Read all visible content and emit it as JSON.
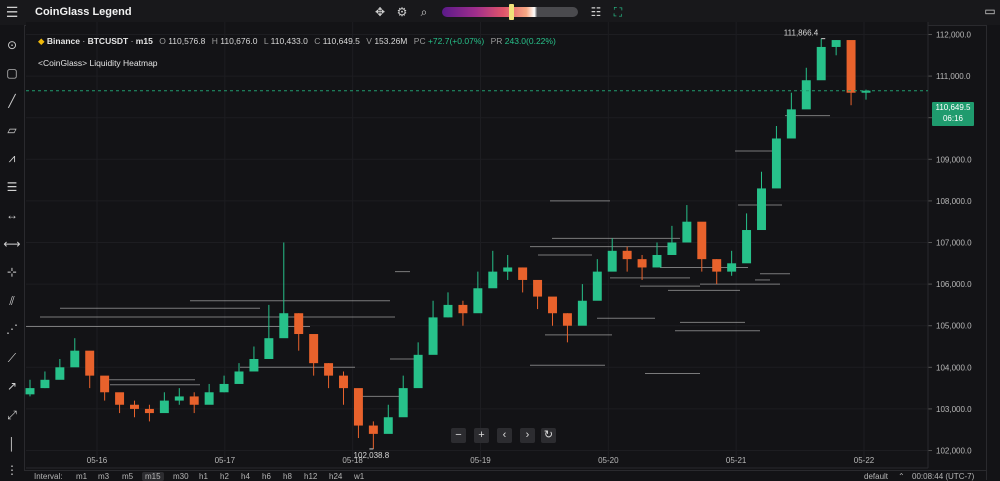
{
  "app": {
    "title": "CoinGlass Legend"
  },
  "legend": {
    "exchange": "Binance",
    "symbol": "BTCUSDT",
    "interval": "m15",
    "open_label": "O",
    "open": "110,576.8",
    "high_label": "H",
    "high": "110,676.0",
    "low_label": "L",
    "low": "110,433.0",
    "close_label": "C",
    "close": "110,649.5",
    "volume_label": "V",
    "volume": "153.26M",
    "pc_label": "PC",
    "pc": "+72.7(+0.07%)",
    "pr_label": "PR",
    "pr": "243.0(0.22%)"
  },
  "indicator": {
    "label": "<CoinGlass> Liquidity Heatmap"
  },
  "price_axis": {
    "ticks": [
      "112,000.0",
      "111,000.0",
      "110,000.0",
      "109,000.0",
      "108,000.0",
      "107,000.0",
      "106,000.0",
      "105,000.0",
      "104,000.0",
      "103,000.0",
      "102,000.0"
    ],
    "current_price": "110,649.5",
    "countdown": "06:16"
  },
  "time_axis": {
    "ticks": [
      "05-16",
      "05-17",
      "05-18",
      "05-19",
      "05-20",
      "05-21",
      "05-22"
    ]
  },
  "annotations": {
    "high": "111,866.4",
    "low": "102,038.8"
  },
  "bottom_bar": {
    "interval_label": "Interval:",
    "intervals": [
      "m1",
      "m3",
      "m5",
      "m15",
      "m30",
      "h1",
      "h2",
      "h4",
      "h6",
      "h8",
      "h12",
      "h24",
      "w1"
    ],
    "active_interval": "m15",
    "scale_mode": "default",
    "time": "00:08:44 (UTC-7)"
  },
  "colors": {
    "up": "#27c18a",
    "down": "#e8622c",
    "accent": "#1f9b6e"
  },
  "chart_data": {
    "type": "candlestick",
    "title": "<CoinGlass> Liquidity Heatmap",
    "x": [
      "05-16",
      "05-17",
      "05-18",
      "05-19",
      "05-20",
      "05-21",
      "05-22"
    ],
    "ylim": [
      101700,
      112300
    ],
    "series": [
      {
        "close": [
          103500,
          103700,
          104000,
          104400,
          103800,
          103400,
          103100,
          103000,
          102900,
          103200,
          103300,
          103100,
          103400,
          103600,
          103900,
          104200,
          104700,
          105300,
          104800,
          104100,
          103800,
          103500,
          102600,
          102400,
          102800,
          103500,
          104300,
          105200,
          105500,
          105300,
          105900,
          106300,
          106400,
          106100,
          105700,
          105300,
          105000,
          105600,
          106300,
          106800,
          106600,
          106400,
          106700,
          107000,
          107500,
          106600,
          106300,
          106500,
          107300,
          108300,
          109500,
          110200,
          110900,
          111700,
          111866,
          110600,
          110649
        ],
        "high": [
          103700,
          103900,
          104200,
          104700,
          103900,
          103700,
          103300,
          103200,
          103100,
          103400,
          103500,
          103400,
          103600,
          103800,
          104100,
          104500,
          105500,
          107000,
          105300,
          104400,
          104100,
          103900,
          102900,
          102700,
          103100,
          103800,
          104600,
          105600,
          105800,
          105600,
          106300,
          106800,
          106700,
          106400,
          105900,
          105500,
          105300,
          106000,
          106600,
          107100,
          106900,
          106700,
          107000,
          107400,
          107900,
          107000,
          106600,
          106800,
          107700,
          108700,
          109800,
          110600,
          111200,
          111900,
          111866,
          110900,
          110676
        ],
        "low": [
          103300,
          103500,
          103800,
          104200,
          103500,
          103200,
          102900,
          102800,
          102700,
          103000,
          103100,
          102900,
          103200,
          103400,
          103700,
          104000,
          104500,
          104900,
          104400,
          103800,
          103500,
          103100,
          102300,
          102038,
          102500,
          103200,
          104000,
          104900,
          105200,
          105000,
          105600,
          106000,
          106100,
          105800,
          105400,
          105000,
          104600,
          105200,
          105900,
          106400,
          106300,
          106100,
          106400,
          106700,
          107200,
          106300,
          106000,
          106200,
          107000,
          107900,
          109100,
          109900,
          110600,
          111400,
          111500,
          110300,
          110433
        ]
      }
    ]
  }
}
